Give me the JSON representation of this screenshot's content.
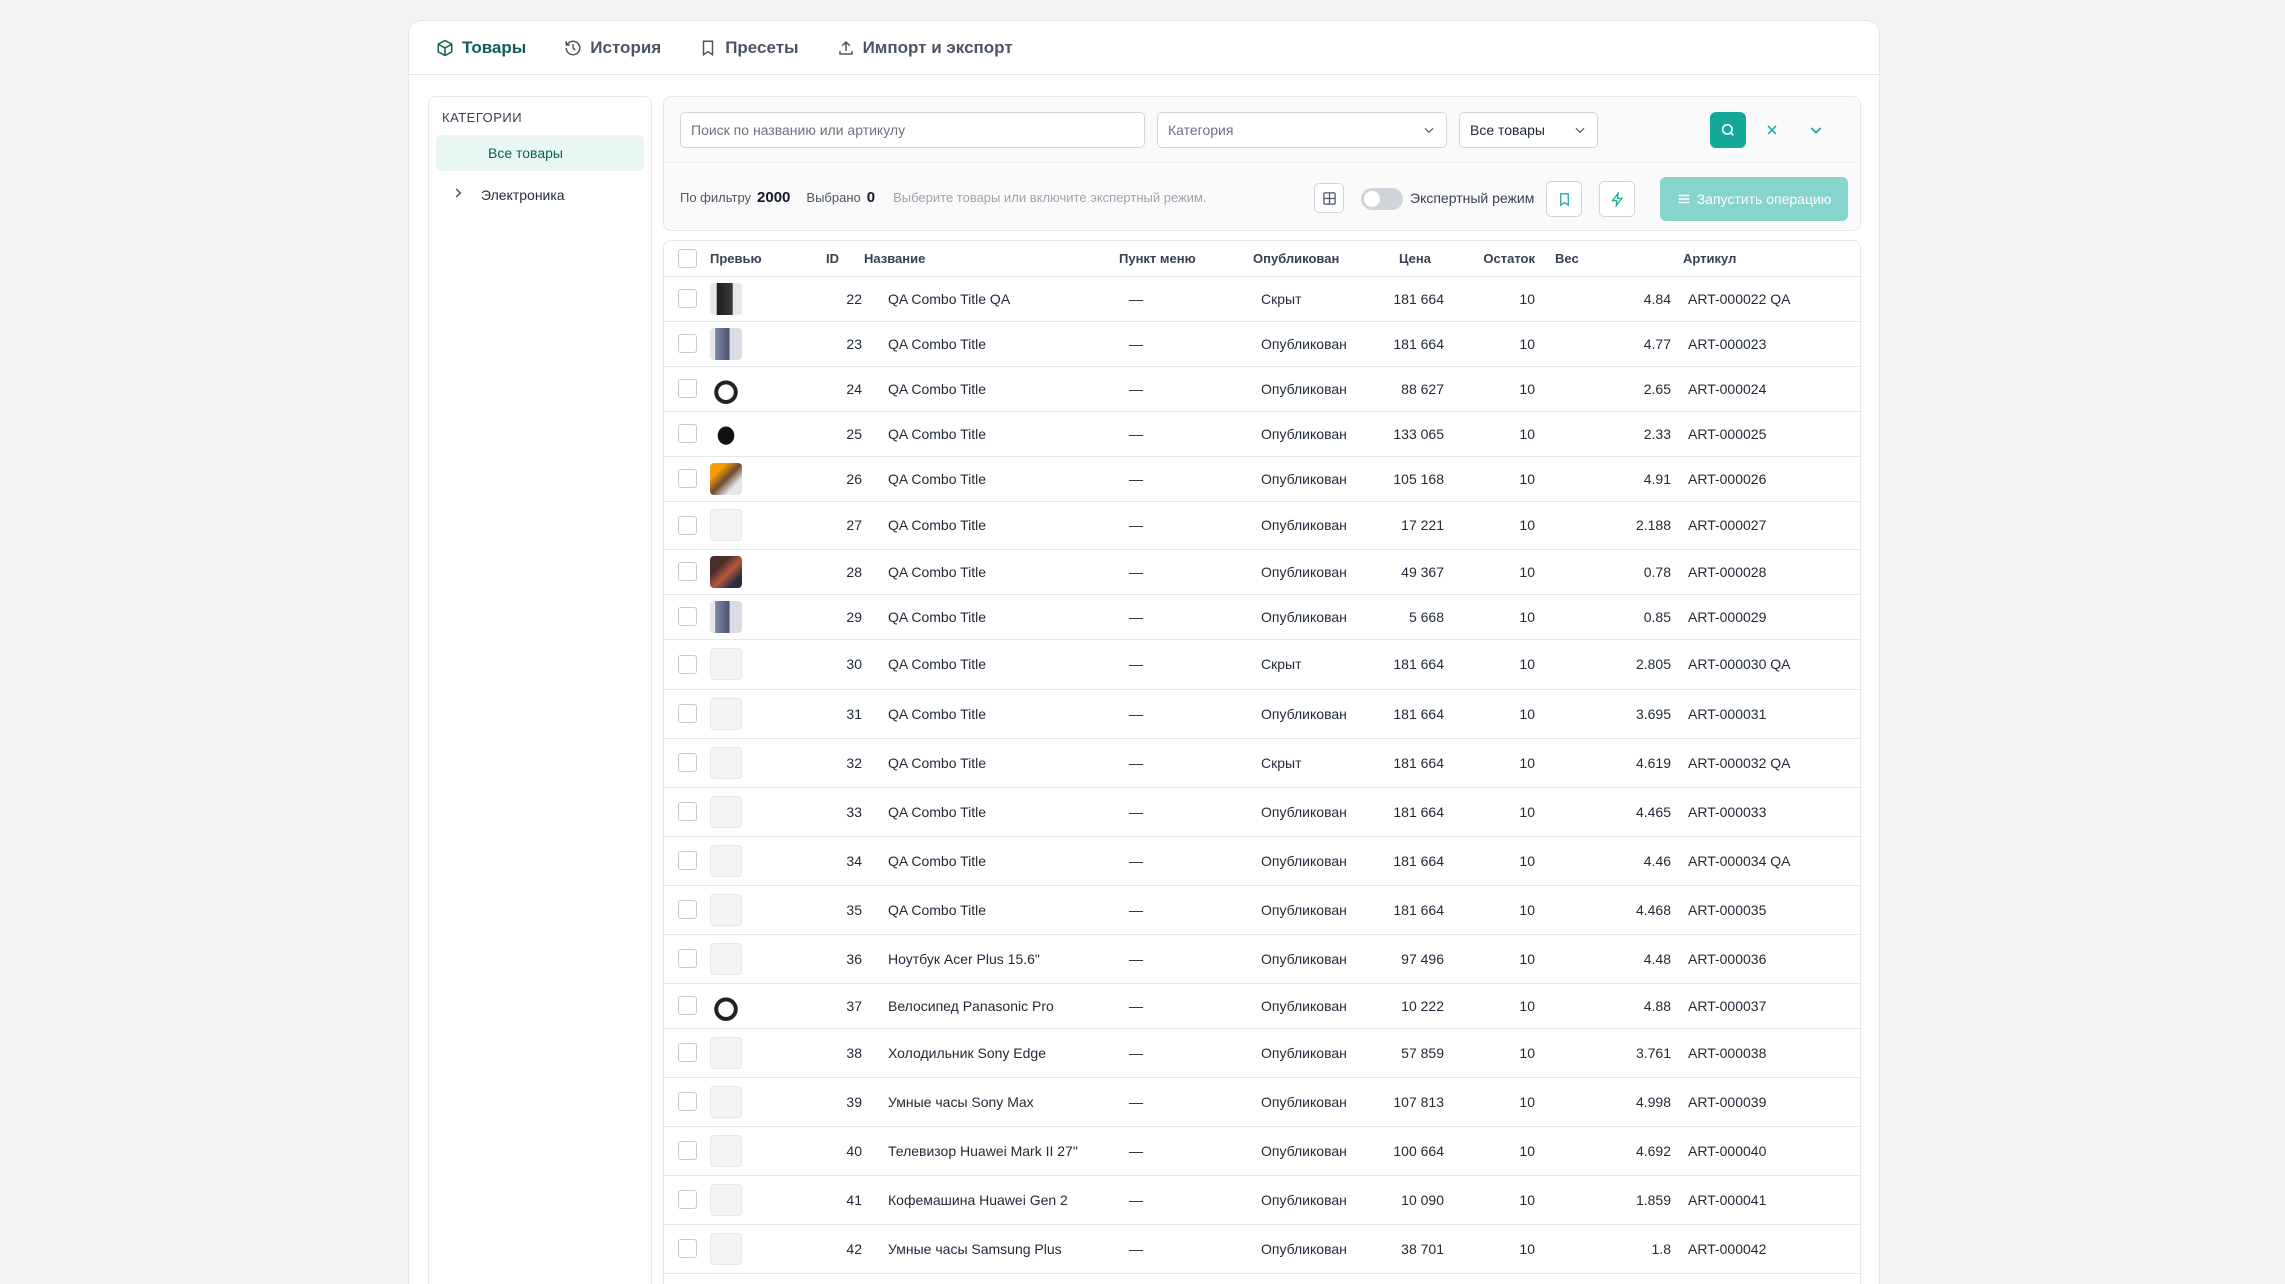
{
  "tabs": [
    {
      "label": "Товары",
      "icon": "cube-icon",
      "active": true
    },
    {
      "label": "История",
      "icon": "history-icon",
      "active": false
    },
    {
      "label": "Пресеты",
      "icon": "bookmark-icon",
      "active": false
    },
    {
      "label": "Импорт и экспорт",
      "icon": "upload-icon",
      "active": false
    }
  ],
  "sidebar": {
    "title": "КАТЕГОРИИ",
    "all_label": "Все товары",
    "tree_item": "Электроника"
  },
  "filters": {
    "search_placeholder": "Поиск по названию или артикулу",
    "category_placeholder": "Категория",
    "scope_value": "Все товары"
  },
  "stats": {
    "filter_label": "По фильтру",
    "filter_count": "2000",
    "selected_label": "Выбрано",
    "selected_count": "0",
    "hint": "Выберите товары или включите экспертный режим."
  },
  "actions": {
    "expert_label": "Экспертный режим",
    "run_label": "Запустить операцию"
  },
  "colors": {
    "accent": "#14a89a",
    "accent_light": "#86d4cb",
    "active_tab": "#0f5f57"
  },
  "table": {
    "headers": [
      "Превью",
      "ID",
      "Название",
      "Пункт меню",
      "Опубликован",
      "Цена",
      "Остаток",
      "Вес",
      "Артикул"
    ],
    "rows": [
      {
        "thumb": "phone",
        "id": "22",
        "name": "QA Combo Title QA",
        "menu": "—",
        "status": "Скрыт",
        "price": "181 664",
        "stock": "10",
        "weight": "4.84",
        "sku": "ART-000022 QA"
      },
      {
        "thumb": "tablet",
        "id": "23",
        "name": "QA Combo Title",
        "menu": "—",
        "status": "Опубликован",
        "price": "181 664",
        "stock": "10",
        "weight": "4.77",
        "sku": "ART-000023"
      },
      {
        "thumb": "headphones",
        "id": "24",
        "name": "QA Combo Title",
        "menu": "—",
        "status": "Опубликован",
        "price": "88 627",
        "stock": "10",
        "weight": "2.65",
        "sku": "ART-000024"
      },
      {
        "thumb": "gamepad",
        "id": "25",
        "name": "QA Combo Title",
        "menu": "—",
        "status": "Опубликован",
        "price": "133 065",
        "stock": "10",
        "weight": "2.33",
        "sku": "ART-000025"
      },
      {
        "thumb": "blender",
        "id": "26",
        "name": "QA Combo Title",
        "menu": "—",
        "status": "Опубликован",
        "price": "105 168",
        "stock": "10",
        "weight": "4.91",
        "sku": "ART-000026"
      },
      {
        "thumb": "empty",
        "id": "27",
        "name": "QA Combo Title",
        "menu": "—",
        "status": "Опубликован",
        "price": "17 221",
        "stock": "10",
        "weight": "2.188",
        "sku": "ART-000027"
      },
      {
        "thumb": "people",
        "id": "28",
        "name": "QA Combo Title",
        "menu": "—",
        "status": "Опубликован",
        "price": "49 367",
        "stock": "10",
        "weight": "0.78",
        "sku": "ART-000028"
      },
      {
        "thumb": "tablet",
        "id": "29",
        "name": "QA Combo Title",
        "menu": "—",
        "status": "Опубликован",
        "price": "5 668",
        "stock": "10",
        "weight": "0.85",
        "sku": "ART-000029"
      },
      {
        "thumb": "empty",
        "id": "30",
        "name": "QA Combo Title",
        "menu": "—",
        "status": "Скрыт",
        "price": "181 664",
        "stock": "10",
        "weight": "2.805",
        "sku": "ART-000030 QA"
      },
      {
        "thumb": "empty",
        "id": "31",
        "name": "QA Combo Title",
        "menu": "—",
        "status": "Опубликован",
        "price": "181 664",
        "stock": "10",
        "weight": "3.695",
        "sku": "ART-000031"
      },
      {
        "thumb": "empty",
        "id": "32",
        "name": "QA Combo Title",
        "menu": "—",
        "status": "Скрыт",
        "price": "181 664",
        "stock": "10",
        "weight": "4.619",
        "sku": "ART-000032 QA"
      },
      {
        "thumb": "empty",
        "id": "33",
        "name": "QA Combo Title",
        "menu": "—",
        "status": "Опубликован",
        "price": "181 664",
        "stock": "10",
        "weight": "4.465",
        "sku": "ART-000033"
      },
      {
        "thumb": "empty",
        "id": "34",
        "name": "QA Combo Title",
        "menu": "—",
        "status": "Опубликован",
        "price": "181 664",
        "stock": "10",
        "weight": "4.46",
        "sku": "ART-000034 QA"
      },
      {
        "thumb": "empty",
        "id": "35",
        "name": "QA Combo Title",
        "menu": "—",
        "status": "Опубликован",
        "price": "181 664",
        "stock": "10",
        "weight": "4.468",
        "sku": "ART-000035"
      },
      {
        "thumb": "empty",
        "id": "36",
        "name": "Ноутбук Acer Plus 15.6\"",
        "menu": "—",
        "status": "Опубликован",
        "price": "97 496",
        "stock": "10",
        "weight": "4.48",
        "sku": "ART-000036"
      },
      {
        "thumb": "headphones",
        "id": "37",
        "name": "Велосипед Panasonic Pro",
        "menu": "—",
        "status": "Опубликован",
        "price": "10 222",
        "stock": "10",
        "weight": "4.88",
        "sku": "ART-000037"
      },
      {
        "thumb": "empty",
        "id": "38",
        "name": "Холодильник Sony Edge",
        "menu": "—",
        "status": "Опубликован",
        "price": "57 859",
        "stock": "10",
        "weight": "3.761",
        "sku": "ART-000038"
      },
      {
        "thumb": "empty",
        "id": "39",
        "name": "Умные часы Sony Max",
        "menu": "—",
        "status": "Опубликован",
        "price": "107 813",
        "stock": "10",
        "weight": "4.998",
        "sku": "ART-000039"
      },
      {
        "thumb": "empty",
        "id": "40",
        "name": "Телевизор Huawei Mark II 27\"",
        "menu": "—",
        "status": "Опубликован",
        "price": "100 664",
        "stock": "10",
        "weight": "4.692",
        "sku": "ART-000040"
      },
      {
        "thumb": "empty",
        "id": "41",
        "name": "Кофемашина Huawei Gen 2",
        "menu": "—",
        "status": "Опубликован",
        "price": "10 090",
        "stock": "10",
        "weight": "1.859",
        "sku": "ART-000041"
      },
      {
        "thumb": "empty",
        "id": "42",
        "name": "Умные часы Samsung Plus",
        "menu": "—",
        "status": "Опубликован",
        "price": "38 701",
        "stock": "10",
        "weight": "1.8",
        "sku": "ART-000042"
      }
    ]
  }
}
